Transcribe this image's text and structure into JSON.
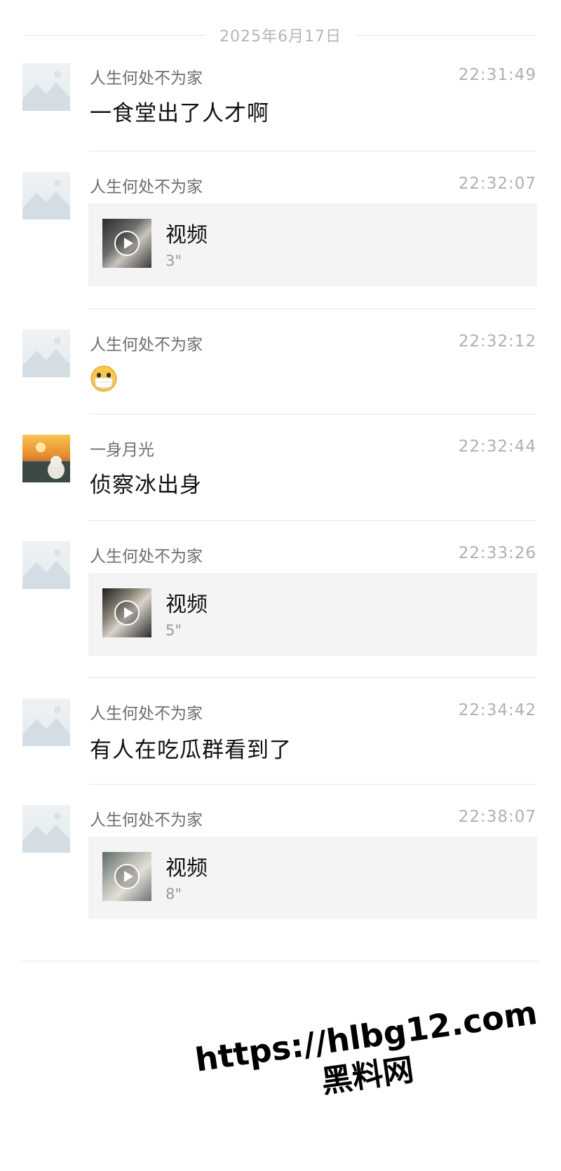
{
  "date_divider": "2025年6月17日",
  "messages": [
    {
      "sender": "人生何处不为家",
      "time": "22:31:49",
      "type": "text",
      "text": "一食堂出了人才啊"
    },
    {
      "sender": "人生何处不为家",
      "time": "22:32:07",
      "type": "video",
      "title": "视频",
      "duration": "3\""
    },
    {
      "sender": "人生何处不为家",
      "time": "22:32:12",
      "type": "emoji",
      "emoji": "face-with-mask-emoji"
    },
    {
      "sender": "一身月光",
      "time": "22:32:44",
      "type": "text",
      "text": "侦察冰出身"
    },
    {
      "sender": "人生何处不为家",
      "time": "22:33:26",
      "type": "video",
      "title": "视频",
      "duration": "5\""
    },
    {
      "sender": "人生何处不为家",
      "time": "22:34:42",
      "type": "text",
      "text": "有人在吃瓜群看到了"
    },
    {
      "sender": "人生何处不为家",
      "time": "22:38:07",
      "type": "video",
      "title": "视频",
      "duration": "8\""
    }
  ],
  "watermark": {
    "url": "https://hlbg12.com",
    "site": "黑料网"
  },
  "colors": {
    "background": "#ffffff",
    "card": "#f4f4f4",
    "secondary_text": "#6e6e6e",
    "time_text": "#b0b0b0"
  }
}
